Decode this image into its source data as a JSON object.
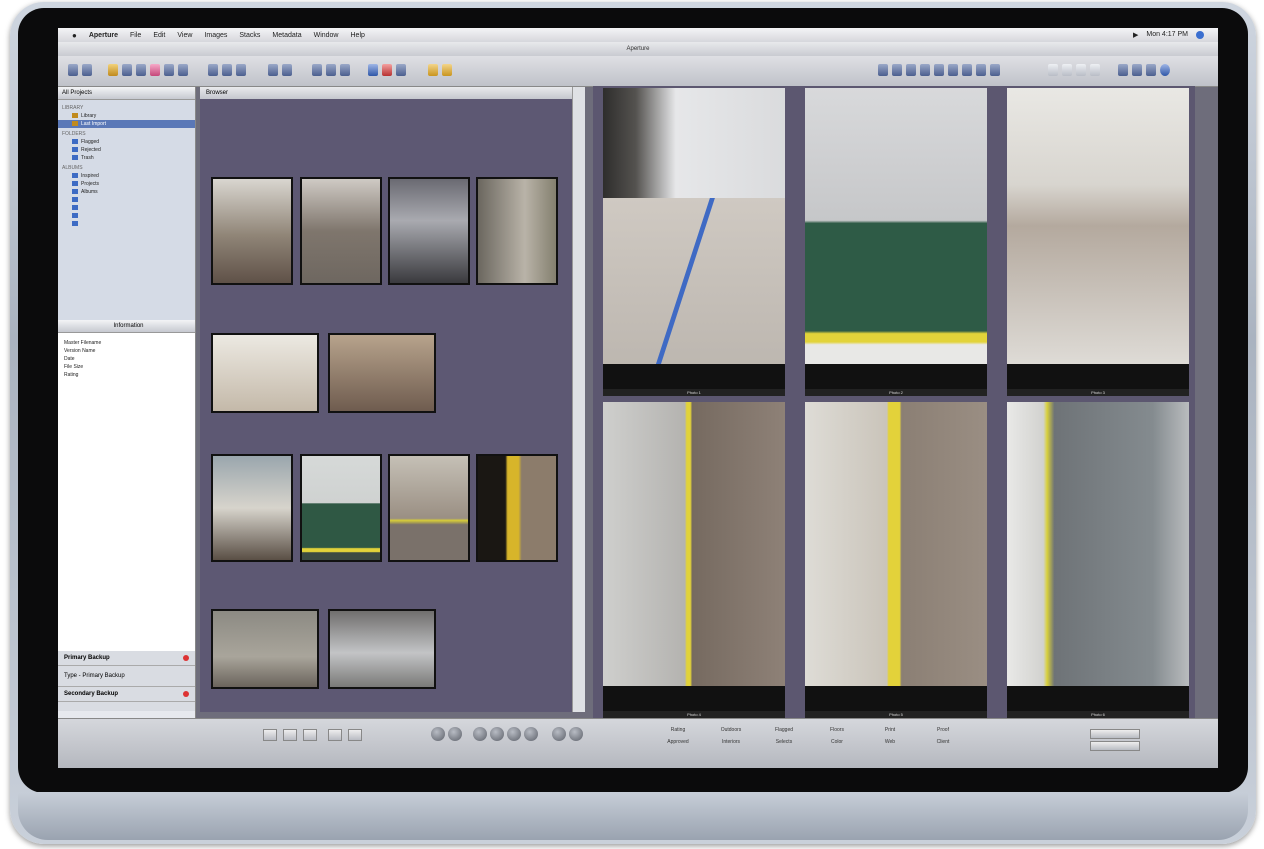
{
  "menubar": {
    "apple": "",
    "app": "Aperture",
    "items": [
      "File",
      "Edit",
      "View",
      "Images",
      "Stacks",
      "Metadata",
      "Window",
      "Help"
    ],
    "clock": "Mon 4:17 PM"
  },
  "window": {
    "title": "Aperture"
  },
  "library": {
    "header": "All Projects",
    "section_library": "LIBRARY",
    "section_folders": "FOLDERS",
    "section_albums": "ALBUMS",
    "items": [
      "Library",
      "Last Import",
      "Flagged",
      "Rejected",
      "Trash",
      "Inspired",
      "Projects",
      "Albums"
    ]
  },
  "metadata_panel": {
    "header": "Information",
    "lines": [
      "Master Filename",
      "Version Name",
      "Date",
      "File Size",
      "Rating"
    ]
  },
  "backup": {
    "primary": "Primary Backup",
    "type_label": "Type - Primary Backup",
    "secondary": "Secondary Backup"
  },
  "browser": {
    "header": "Browser"
  },
  "viewer": {
    "photos": [
      {
        "name": "Photo 1"
      },
      {
        "name": "Photo 2"
      },
      {
        "name": "Photo 3"
      },
      {
        "name": "Photo 4"
      },
      {
        "name": "Photo 5"
      },
      {
        "name": "Photo 6"
      }
    ]
  },
  "bottombar": {
    "keywords": [
      "Rating",
      "Approved",
      "Outdoors",
      "Interiors",
      "Flagged",
      "Selects",
      "Floors",
      "Color",
      "Print",
      "Web",
      "Proof",
      "Client"
    ]
  },
  "colors": {
    "browser_bg": "#5d5873",
    "viewer_bg": "#5c5770",
    "selection": "#5a78b7"
  }
}
